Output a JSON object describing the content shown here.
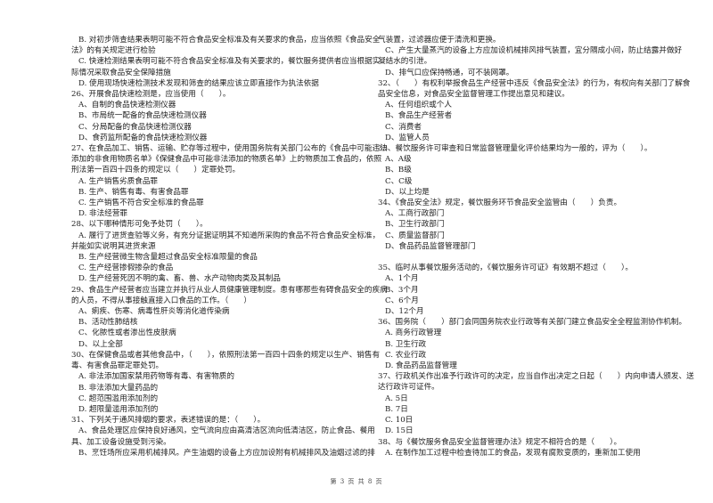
{
  "left_column": [
    {
      "type": "opt",
      "text": "B. 对初步筛查结果表明可能不符合食品安全标准及有关要求的食品，应当依照《食品安全"
    },
    {
      "type": "cont",
      "text": "法》的有关规定进行检验"
    },
    {
      "type": "opt",
      "text": "C. 快速检测结果表明可能不符合食品安全标准及有关要求的，餐饮服务提供者应当根据实"
    },
    {
      "type": "cont",
      "text": "际情况采取食品安全保障措施"
    },
    {
      "type": "opt",
      "text": "D. 使用现场快速检测技术发现和筛查的结果应该立即直接作为执法依据"
    },
    {
      "type": "q",
      "text": "26、开展食品快速检测是，应当使用（　　）。"
    },
    {
      "type": "opt",
      "text": "A、自制的食品快速检测仪器"
    },
    {
      "type": "opt",
      "text": "B、市局统一配备的食品快速检测仪器"
    },
    {
      "type": "opt",
      "text": "C、分局配备的食品快速检测仪器"
    },
    {
      "type": "opt",
      "text": "D、食药监所配备的食品快速检测仪器"
    },
    {
      "type": "q",
      "text": "27、在食品加工、销售、运输、贮存等过程中，使用国务院有关部门公布的《食品中可能违法"
    },
    {
      "type": "cont",
      "text": "添加的非食用物质名单》《保健食品中可能非法添加的物质名单》上的物质加工食品的，依照"
    },
    {
      "type": "cont",
      "text": "刑法第一百四十四条的规定以（　　）定罪处罚。"
    },
    {
      "type": "opt",
      "text": "A. 生产销售劣质食品罪"
    },
    {
      "type": "opt",
      "text": "B. 生产、销售有毒、有害食品罪"
    },
    {
      "type": "opt",
      "text": "C. 生产销售不符合安全标准的食品罪"
    },
    {
      "type": "opt",
      "text": "D. 非法经营罪"
    },
    {
      "type": "q",
      "text": "28、以下哪种情形可免予处罚（　　）。"
    },
    {
      "type": "opt",
      "text": "A. 履行了进货查验等义务，有充分证据证明其不知道所采购的食品不符合食品安全标准，"
    },
    {
      "type": "cont",
      "text": "并能如实说明其进货来源"
    },
    {
      "type": "opt",
      "text": "B. 生产经营微生物含量超过食品安全标准限量的食品"
    },
    {
      "type": "opt",
      "text": "C. 生产经营掺假掺杂的食品"
    },
    {
      "type": "opt",
      "text": "D. 生产经营死因不明的禽、畜、兽、水产动物肉类及其制品"
    },
    {
      "type": "q",
      "text": "29、食品生产经营者应当建立并执行从业人员健康管理制度。患有哪那些有碍食品安全的疾病"
    },
    {
      "type": "cont",
      "text": "的人员，不得从事接触直接入口食品的工作。（　　）"
    },
    {
      "type": "opt",
      "text": "A、痢疾、伤寒、病毒性肝炎等消化道传染病"
    },
    {
      "type": "opt",
      "text": "B、活动性肺结核"
    },
    {
      "type": "opt",
      "text": "C、化脓性或者渗出性皮肤病"
    },
    {
      "type": "opt",
      "text": "D、以上全部"
    },
    {
      "type": "q",
      "text": "30、在保健食品或者其他食品中，（　　），依照刑法第一百四十四条的规定以生产、销售有"
    },
    {
      "type": "cont",
      "text": "毒、有害食品罪定罪处罚。"
    },
    {
      "type": "opt",
      "text": "A. 非法添加国家禁用药物等有毒、有害物质的"
    },
    {
      "type": "opt",
      "text": "B. 非法添加大量药品的"
    },
    {
      "type": "opt",
      "text": "C. 超范围滥用添加剂的"
    },
    {
      "type": "opt",
      "text": "D. 超限量滥用添加剂的"
    },
    {
      "type": "q",
      "text": "31、下列关于通风排烟的要求，表述错误的是：（　　）。"
    },
    {
      "type": "opt",
      "text": "A、食品处理区应保持良好通风，空气流向应由高清洁区流向低清洁区，防止食品、餐用"
    },
    {
      "type": "cont",
      "text": "具、加工设备设施受到污染。"
    },
    {
      "type": "opt",
      "text": "B、烹饪场所应采用机械排风。产生油烟的设备上方应加设附有机械排风及油烟过滤的排"
    }
  ],
  "right_column": [
    {
      "type": "cont",
      "text": "气装置，过滤器应便于清洗和更换。"
    },
    {
      "type": "opt",
      "text": "C、产生大量蒸汽的设备上方应加设机械排风排气装置，宜分隔成小间，防止结露并做好"
    },
    {
      "type": "cont",
      "text": "凝结水的引泄。"
    },
    {
      "type": "opt",
      "text": "D、排气口应保持畅通，可不装网罩。"
    },
    {
      "type": "q",
      "text": "32、（　　）有权利举报食品生产经营中违反《食品安全法》的行为，有权向有关部门了解食"
    },
    {
      "type": "cont",
      "text": "品安全信息，对食品安全监督管理工作提出意见和建议。"
    },
    {
      "type": "opt",
      "text": "A、任何组织或个人"
    },
    {
      "type": "opt",
      "text": "B、食品生产经营者"
    },
    {
      "type": "opt",
      "text": "C、消费者"
    },
    {
      "type": "opt",
      "text": "D、监管人员"
    },
    {
      "type": "q",
      "text": "33、餐饮服务许可审查和日常监督管理量化评价结果均为一般的，评为（　　）。"
    },
    {
      "type": "opt",
      "text": "A、A级"
    },
    {
      "type": "opt",
      "text": "B、B级"
    },
    {
      "type": "opt",
      "text": "C、C级"
    },
    {
      "type": "opt",
      "text": "D、以上均是"
    },
    {
      "type": "q",
      "text": "34、《食品安全法》规定，餐饮服务环节食品安全监管由（　　）负责。"
    },
    {
      "type": "opt",
      "text": "A、工商行政部门"
    },
    {
      "type": "opt",
      "text": "B、卫生行政部门"
    },
    {
      "type": "opt",
      "text": "C、质量监督部门"
    },
    {
      "type": "opt",
      "text": "D、食品药品监督管理部门"
    },
    {
      "type": "gap",
      "text": ""
    },
    {
      "type": "q",
      "text": "35、临时从事餐饮服务活动的，《餐饮服务许可证》有效期不超过（　　）。"
    },
    {
      "type": "opt",
      "text": "A、1个月"
    },
    {
      "type": "opt",
      "text": "B、3个月"
    },
    {
      "type": "opt",
      "text": "C、6个月"
    },
    {
      "type": "opt",
      "text": "D、12个月"
    },
    {
      "type": "q",
      "text": "36、国务院（　　）部门会同国务院农业行政等有关部门建立食品安全全程监测协作机制。"
    },
    {
      "type": "opt",
      "text": "A. 商务行政管理"
    },
    {
      "type": "opt",
      "text": "B. 卫生行政"
    },
    {
      "type": "opt",
      "text": "C. 农业行政"
    },
    {
      "type": "opt",
      "text": "D. 食品药品监督管理"
    },
    {
      "type": "q",
      "text": "37、行政机关作出准予行政许可的决定，应当自作出决定之日起（　　）内向申请人颁发、送"
    },
    {
      "type": "cont",
      "text": "达行政许可证件。"
    },
    {
      "type": "opt",
      "text": "A. 5日"
    },
    {
      "type": "opt",
      "text": "B. 7日"
    },
    {
      "type": "opt",
      "text": "C. 10日"
    },
    {
      "type": "opt",
      "text": "D. 15日"
    },
    {
      "type": "q",
      "text": "38、与《餐饮服务食品安全监督管理办法》规定不相符合的是（　　）。"
    },
    {
      "type": "opt",
      "text": "A. 在制作加工过程中检查待加工的食品，发现有腐败变质的，重新加工使用"
    }
  ],
  "footer": {
    "page_label": "第 3 页 共 8 页"
  }
}
